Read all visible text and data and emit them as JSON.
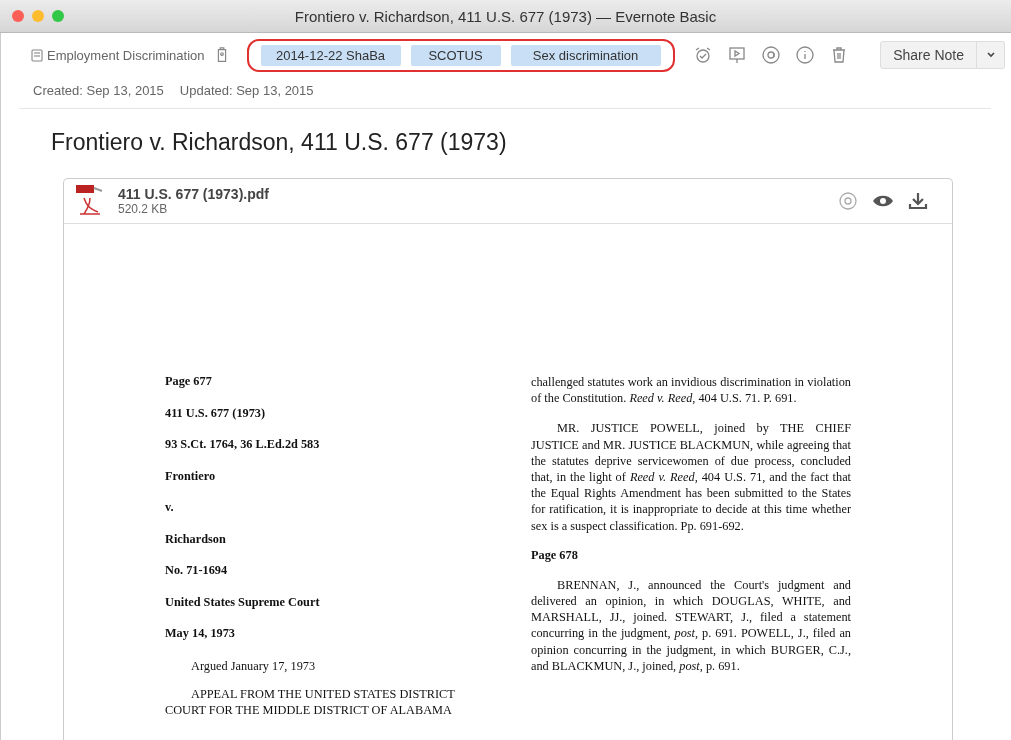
{
  "window": {
    "title": "Frontiero v. Richardson, 411 U.S. 677 (1973) — Evernote Basic"
  },
  "toolbar": {
    "notebook": "Employment Discrimination",
    "tags": [
      "2014-12-22 ShaBa",
      "SCOTUS",
      "Sex discrimination"
    ],
    "tags_highlighted": true,
    "share_button": "Share Note"
  },
  "meta": {
    "created": "Created: Sep 13, 2015",
    "updated": "Updated: Sep 13, 2015"
  },
  "note": {
    "title": "Frontiero v. Richardson, 411 U.S. 677 (1973)"
  },
  "attachment": {
    "file_name": "411 U.S. 677 (1973).pdf",
    "file_size": "520.2 KB",
    "left_column": [
      {
        "kind": "heading",
        "text": "Page 677"
      },
      {
        "kind": "heading",
        "text": "411 U.S. 677 (1973)"
      },
      {
        "kind": "heading",
        "text": "93 S.Ct. 1764, 36 L.Ed.2d 583"
      },
      {
        "kind": "heading",
        "text": "Frontiero"
      },
      {
        "kind": "heading",
        "text": "v."
      },
      {
        "kind": "heading",
        "text": "Richardson"
      },
      {
        "kind": "heading",
        "text": "No. 71-1694"
      },
      {
        "kind": "heading",
        "text": "United States Supreme Court"
      },
      {
        "kind": "heading",
        "text": "May 14, 1973"
      },
      {
        "kind": "paragraph",
        "text": "Argued January 17, 1973"
      },
      {
        "kind": "paragraph",
        "text": "APPEAL FROM THE UNITED STATES DISTRICT COURT FOR THE MIDDLE DISTRICT OF ALABAMA"
      }
    ],
    "right_column": [
      {
        "kind": "continuation",
        "text": "challenged statutes work an invidious discrimination in violation of the Constitution. *Reed v. Reed*, 404 U.S. 71. P. 691."
      },
      {
        "kind": "paragraph",
        "text": "MR. JUSTICE POWELL, joined by THE CHIEF JUSTICE and MR. JUSTICE BLACKMUN, while agreeing that the statutes deprive servicewomen of due process, concluded that, in the light of *Reed v. Reed*, 404 U.S. 71, and the fact that the Equal Rights Amendment has been submitted to the States for ratification, it is inappropriate to decide at this time whether sex is a suspect classification. Pp. 691-692."
      },
      {
        "kind": "heading",
        "text": "Page 678"
      },
      {
        "kind": "paragraph",
        "text": "BRENNAN, J., announced the Court's judgment and delivered an opinion, in which DOUGLAS, WHITE, and MARSHALL, JJ., joined. STEWART, J., filed a statement concurring in the judgment, *post*, p. 691. POWELL, J., filed an opinion concurring in the judgment, in which BURGER, C.J., and BLACKMUN, J., joined, *post*, p. 691."
      }
    ]
  }
}
